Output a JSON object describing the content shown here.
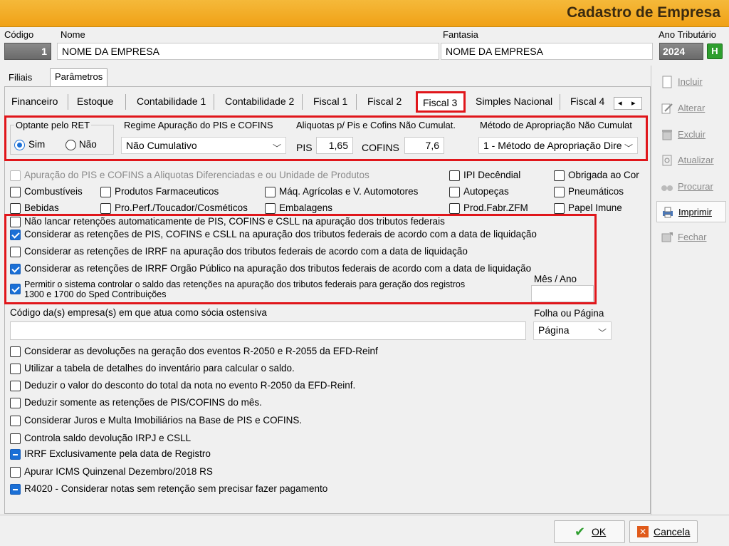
{
  "window": {
    "title": "Cadastro de Empresa"
  },
  "header": {
    "codigo_label": "Código",
    "codigo_value": "1",
    "nome_label": "Nome",
    "nome_value": "NOME DA EMPRESA",
    "fantasia_label": "Fantasia",
    "fantasia_value": "NOME DA EMPRESA",
    "ano_label": "Ano Tributário",
    "ano_value": "2024",
    "ano_button": "H"
  },
  "outer_tabs": [
    "Filiais",
    "Parâmetros"
  ],
  "inner_tabs": [
    "Financeiro",
    "Estoque",
    "Contabilidade 1",
    "Contabilidade 2",
    "Fiscal 1",
    "Fiscal 2",
    "Fiscal 3",
    "Simples Nacional",
    "Fiscal 4"
  ],
  "tab_nav": {
    "prev": "◂",
    "next": "▸"
  },
  "ret": {
    "label": "Optante pelo RET",
    "sim": "Sim",
    "nao": "Não"
  },
  "regime": {
    "label": "Regime Apuração do PIS e COFINS",
    "value": "Não Cumulativo"
  },
  "aliquotas": {
    "label": "Aliquotas p/  Pis e Cofins Não Cumulat.",
    "pis_label": "PIS",
    "pis_value": "1,65",
    "cofins_label": "COFINS",
    "cofins_value": "7,6"
  },
  "metodo": {
    "label": "Método de Apropriação Não Cumulat",
    "value": "1 - Método de Apropriação Dire"
  },
  "checks_grid": {
    "diferenciadas": "Apuração do PIS e COFINS a Aliquotas Diferenciadas e ou Unidade de Produtos",
    "ipi_decendial": "IPI Decêndial",
    "obrigada": "Obrigada ao Cor",
    "combustiveis": "Combustíveis",
    "farmaceuticos": "Produtos Farmaceuticos",
    "maq_agricolas": "Máq. Agrícolas e V. Automotores",
    "autopecas": "Autopeças",
    "pneumaticos": "Pneumáticos",
    "bebidas": "Bebidas",
    "pro_perf": "Pro.Perf./Toucador/Cosméticos",
    "embalagens": "Embalagens",
    "prod_fabr": "Prod.Fabr.ZFM",
    "papel_imune": "Papel Imune"
  },
  "retencoes": {
    "nao_lancar": "Não lancar retenções automaticamente de PIS, COFINS e CSLL na apuração dos tributos federais",
    "considerar_pis": "Considerar as retenções de PIS, COFINS e CSLL na apuração dos tributos federais de acordo com a data de liquidação",
    "considerar_irrf": "Considerar as retenções de IRRF na apuração dos tributos federais de acordo com a data de liquidação",
    "considerar_orgao": "Considerar as retenções de IRRF Orgão Público na apuração dos tributos federais de acordo com a data de liquidação",
    "permitir_1": "Permitir o sistema controlar o saldo das retenções na apuração dos tributos federais para geração dos registros",
    "permitir_2": "1300 e 1700 do Sped Contribuições",
    "mes_ano_label": "Mês / Ano",
    "mes_ano_value": ""
  },
  "socia": {
    "label": "Código da(s) empresa(s) em que atua como sócia ostensiva",
    "value": ""
  },
  "folha": {
    "label": "Folha ou Página",
    "value": "Página"
  },
  "options": [
    "Considerar as devoluções na geração dos eventos R-2050 e R-2055 da EFD-Reinf",
    "Utilizar a tabela de detalhes do inventário para calcular o saldo.",
    "Deduzir o valor do desconto do total da nota no evento R-2050 da EFD-Reinf.",
    "Deduzir somente as retenções de PIS/COFINS do mês.",
    "Considerar Juros e Multa Imobiliários na Base de PIS e COFINS.",
    "Controla saldo devolução IRPJ e CSLL",
    "IRRF Exclusivamente pela data de Registro",
    "Apurar ICMS Quinzenal Dezembro/2018 RS",
    "R4020 - Considerar notas sem retenção sem precisar fazer pagamento"
  ],
  "side_buttons": [
    "Incluir",
    "Alterar",
    "Excluir",
    "Atualizar",
    "Procurar",
    "Imprimir",
    "Fechar"
  ],
  "footer": {
    "ok": "OK",
    "cancel": "Cancela"
  },
  "colors": {
    "title_bar": "#f0a116",
    "highlight": "#e0161b",
    "checkbox": "#1a6fd6"
  }
}
